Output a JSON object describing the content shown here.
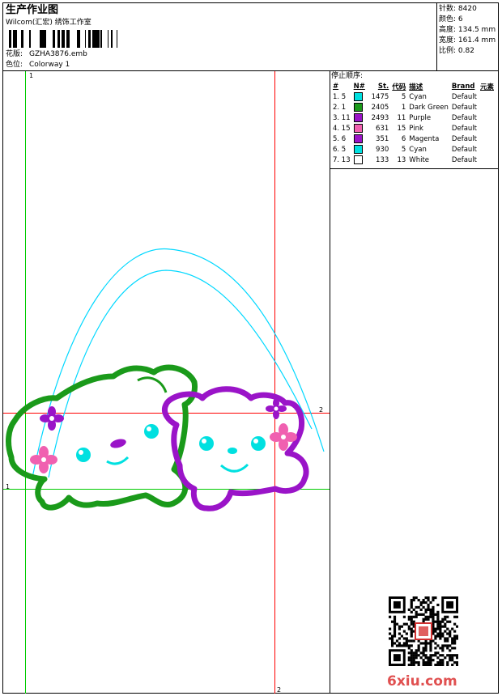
{
  "header": {
    "title": "生产作业图",
    "company": "Wilcom(汇宏) 绣饰工作室",
    "design_label": "花版:",
    "design_value": "GZHA3876.emb",
    "colorway_label": "色位:",
    "colorway_value": "Colorway 1"
  },
  "stats": {
    "stitches_label": "针数:",
    "stitches_value": "8420",
    "colors_label": "颜色:",
    "colors_value": "6",
    "height_label": "高度:",
    "height_value": "134.5 mm",
    "width_label": "宽度:",
    "width_value": "161.4 mm",
    "scale_label": "比例:",
    "scale_value": "0.82"
  },
  "stop_sequence": {
    "title": "停止顺序:",
    "headers": [
      "#",
      "N#",
      "St.",
      "代码",
      "描述",
      "Brand",
      "元素"
    ],
    "rows": [
      {
        "idx": "1. 5",
        "st": "1475",
        "code": "5",
        "desc": "Cyan",
        "brand": "Default",
        "color": "#00e0e0"
      },
      {
        "idx": "2. 1",
        "st": "2405",
        "code": "1",
        "desc": "Dark Green",
        "brand": "Default",
        "color": "#1a9a1a"
      },
      {
        "idx": "3. 11",
        "st": "2493",
        "code": "11",
        "desc": "Purple",
        "brand": "Default",
        "color": "#9a14c8"
      },
      {
        "idx": "4. 15",
        "st": "631",
        "code": "15",
        "desc": "Pink",
        "brand": "Default",
        "color": "#f060b0"
      },
      {
        "idx": "5. 6",
        "st": "351",
        "code": "6",
        "desc": "Magenta",
        "brand": "Default",
        "color": "#9a14c8"
      },
      {
        "idx": "6. 5",
        "st": "930",
        "code": "5",
        "desc": "Cyan",
        "brand": "Default",
        "color": "#00e0e0"
      },
      {
        "idx": "7. 13",
        "st": "133",
        "code": "13",
        "desc": "White",
        "brand": "Default",
        "color": "#ffffff"
      }
    ]
  },
  "markers": {
    "top_left": "1",
    "left_mid": "1",
    "right_mid": "2",
    "bottom": "2"
  },
  "watermark": "6xiu.com"
}
